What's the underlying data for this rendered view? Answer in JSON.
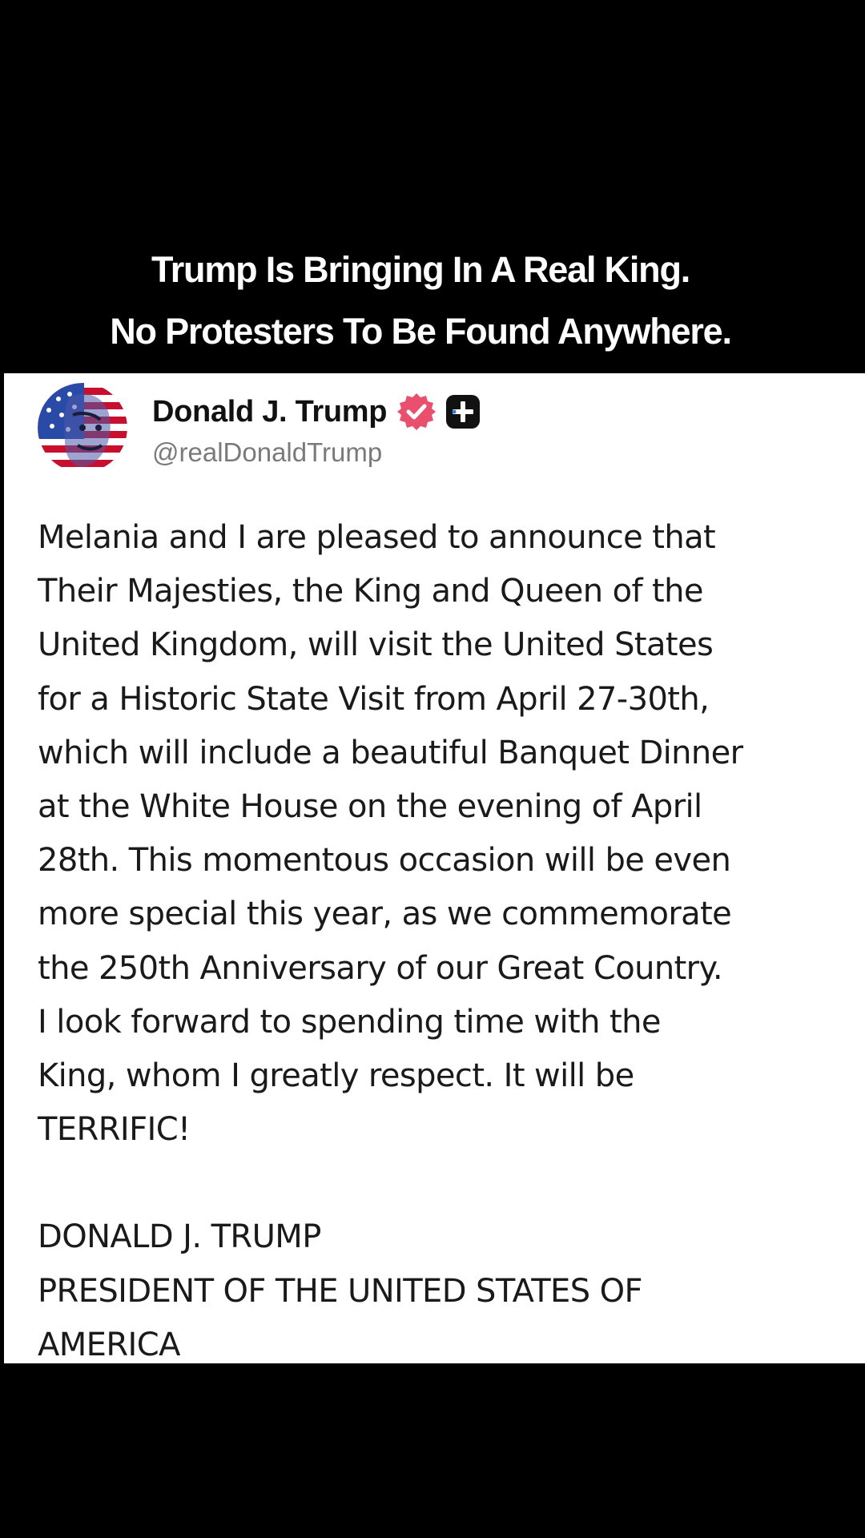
{
  "caption": {
    "line1": "Trump Is Bringing In A Real King.",
    "line2": "No Protesters To Be Found Anywhere."
  },
  "post": {
    "author_name": "Donald J. Trump",
    "handle": "@realDonaldTrump",
    "avatar_icon": "flag-portrait-avatar",
    "verified_icon": "verified-badge-icon",
    "verified_color": "#e8506e",
    "plus_icon": "plus-badge-icon",
    "body_lines": [
      "Melania and I are pleased to announce that",
      "Their Majesties, the King and Queen of the",
      "United Kingdom, will visit the United States",
      "for a Historic State Visit from April 27-30th,",
      "which will include a beautiful Banquet Dinner",
      "at the White House on the evening of April",
      "28th. This momentous occasion will be even",
      "more special this year, as we commemorate",
      "the 250th Anniversary of our Great Country.",
      "I look forward to spending time with the",
      "King, whom I greatly respect. It will be",
      "TERRIFIC!"
    ],
    "signature_lines": [
      "DONALD J. TRUMP",
      "PRESIDENT OF THE UNITED STATES OF",
      "AMERICA"
    ]
  }
}
